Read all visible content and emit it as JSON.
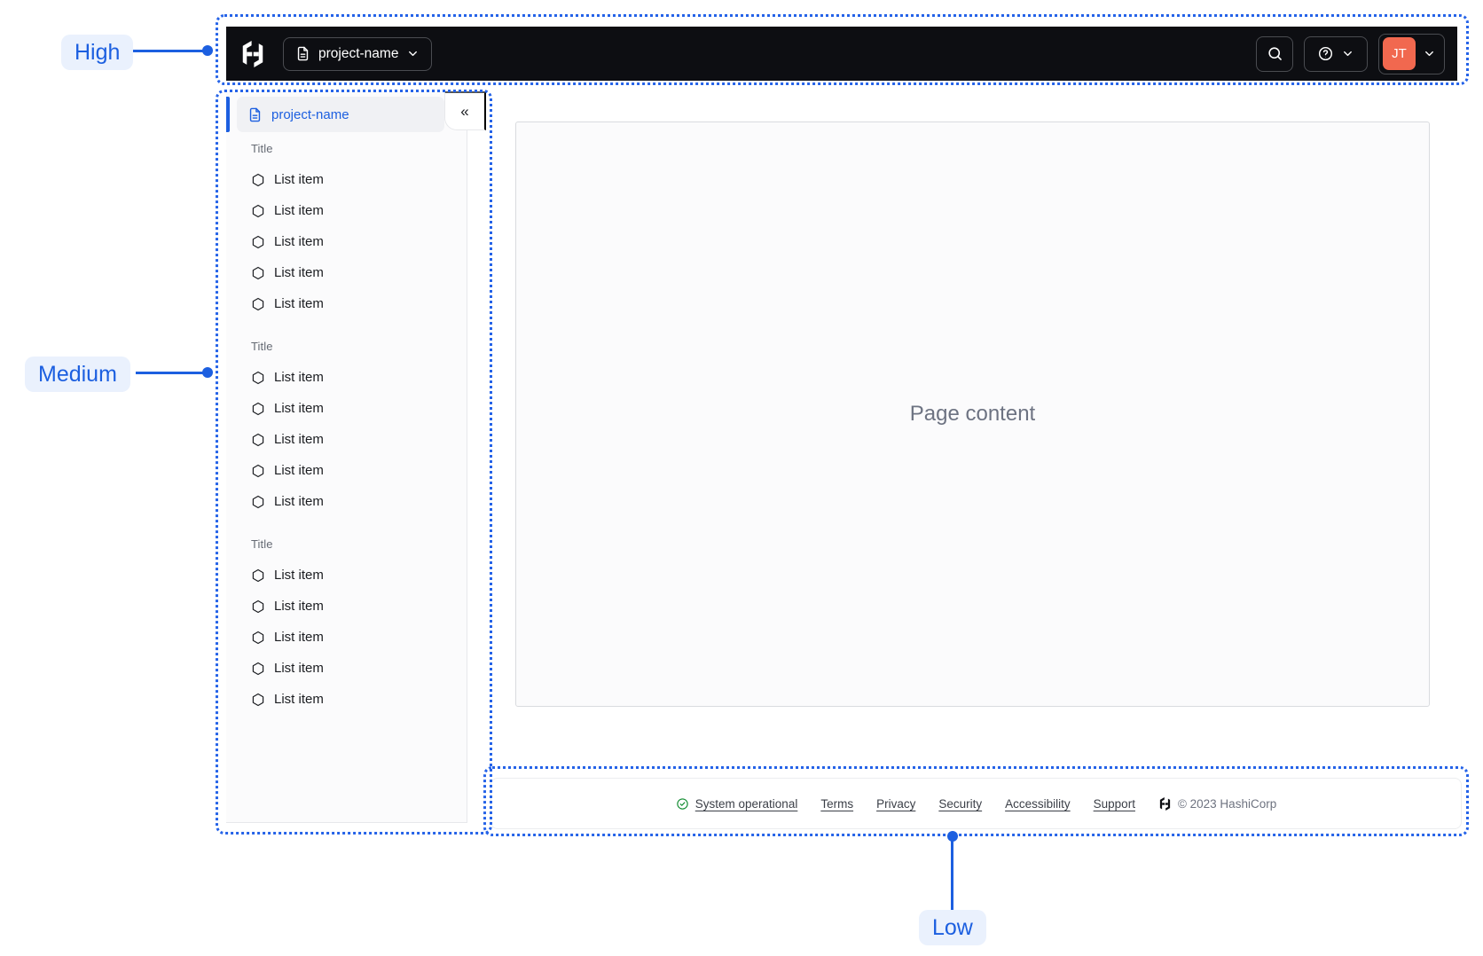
{
  "annotations": {
    "high": "High",
    "medium": "Medium",
    "low": "Low",
    "accent_color": "#1C5FE0",
    "label_bg_color": "#EAF1FD"
  },
  "navbar": {
    "logo": "hashicorp-logo",
    "project_switcher": {
      "label": "project-name",
      "icon": "file-text-icon"
    },
    "actions": {
      "search_icon": "search-icon",
      "help_icon": "help-icon",
      "avatar": {
        "initials": "JT",
        "color": "#F1684F"
      }
    }
  },
  "sidebar": {
    "header": {
      "label": "project-name",
      "icon": "file-text-icon"
    },
    "collapse_label": "«",
    "groups": [
      {
        "title": "Title",
        "items": [
          "List item",
          "List item",
          "List item",
          "List item",
          "List item"
        ]
      },
      {
        "title": "Title",
        "items": [
          "List item",
          "List item",
          "List item",
          "List item",
          "List item"
        ]
      },
      {
        "title": "Title",
        "items": [
          "List item",
          "List item",
          "List item",
          "List item",
          "List item"
        ]
      }
    ]
  },
  "main": {
    "placeholder": "Page content"
  },
  "footer": {
    "status": "System operational",
    "status_color": "#0E8A2E",
    "links": [
      "Terms",
      "Privacy",
      "Security",
      "Accessibility",
      "Support"
    ],
    "copyright": "© 2023 HashiCorp"
  }
}
